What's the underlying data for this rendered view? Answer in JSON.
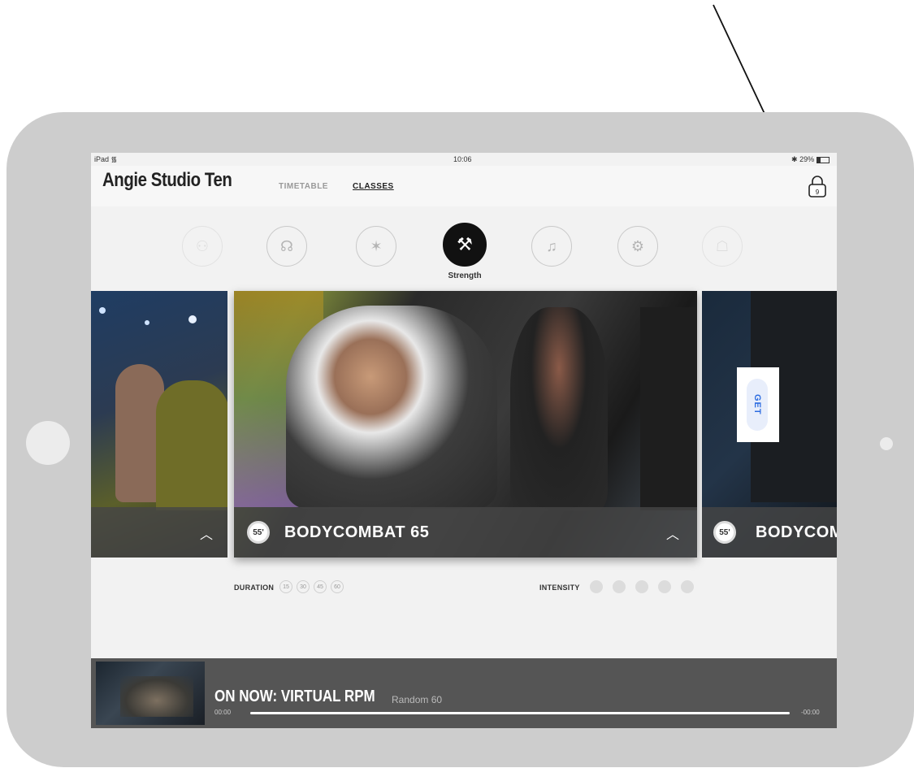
{
  "status_bar": {
    "device": "iPad",
    "time": "10:06",
    "battery": "29%"
  },
  "header": {
    "studio_name": "Angie Studio Ten",
    "tabs": [
      {
        "label": "TIMETABLE",
        "active": false
      },
      {
        "label": "CLASSES",
        "active": true
      }
    ],
    "lock_badge": "9"
  },
  "categories": {
    "items": [
      {
        "icon": "partner-workout-icon",
        "state": "faded"
      },
      {
        "icon": "mat-exercise-icon",
        "state": "inactive"
      },
      {
        "icon": "martial-arts-kick-icon",
        "state": "inactive"
      },
      {
        "icon": "weightlifting-icon",
        "state": "active"
      },
      {
        "icon": "dance-icon",
        "state": "inactive"
      },
      {
        "icon": "kettlebell-icon",
        "state": "inactive"
      },
      {
        "icon": "yoga-pose-icon",
        "state": "faded"
      }
    ],
    "active_label": "Strength"
  },
  "cards": {
    "main": {
      "title": "BODYCOMBAT 65",
      "duration_badge": "55'"
    },
    "next": {
      "title": "BODYCOMB",
      "duration_badge": "55'",
      "get_label": "GET"
    }
  },
  "filters": {
    "duration_label": "DURATION",
    "durations": [
      "15",
      "30",
      "45",
      "60"
    ],
    "intensity_label": "INTENSITY",
    "intensity_levels": 5
  },
  "now_playing": {
    "title": "ON NOW: VIRTUAL RPM",
    "subtitle": "Random 60",
    "elapsed": "00:00",
    "remaining": "-00:00"
  },
  "colors": {
    "accent_get": "#2b6be0",
    "frame": "#cdcdcd",
    "dark_bar": "#555555"
  }
}
